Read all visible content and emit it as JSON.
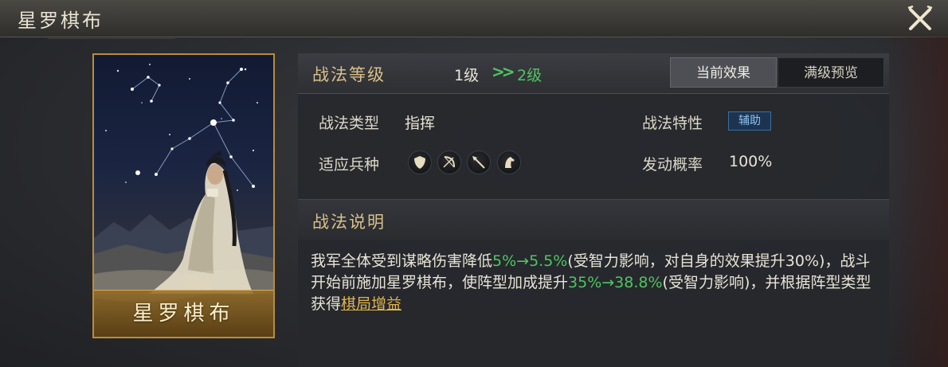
{
  "window": {
    "title": "星罗棋布"
  },
  "card": {
    "name": "星罗棋布"
  },
  "level": {
    "label": "战法等级",
    "from": "1级",
    "arrow": ">>",
    "to": "2级"
  },
  "tabs": [
    {
      "label": "当前效果",
      "active": true
    },
    {
      "label": "满级预览",
      "active": false
    }
  ],
  "attributes": {
    "type_label": "战法类型",
    "type_value": "指挥",
    "trait_label": "战法特性",
    "trait_value": "辅助",
    "units_label": "适应兵种",
    "units": [
      "shield-unit-icon",
      "bow-unit-icon",
      "spear-unit-icon",
      "cavalry-unit-icon"
    ],
    "chance_label": "发动概率",
    "chance_value": "100%"
  },
  "description": {
    "header": "战法说明",
    "p1": "我军全体受到谋略伤害降低",
    "v1": "5%→5.5%",
    "p2": "(受智力影响，对自身的效果提升30%)，战斗开始前施加星罗棋布，使阵型加成提升",
    "v2": "35%→38.8%",
    "p3": "(受智力影响)，并根据阵型类型获得",
    "link": "棋局增益"
  },
  "colors": {
    "accent_gold": "#d9c08a",
    "upgrade_green": "#4fc560",
    "link_gold": "#e0b54e",
    "badge_blue": "#8fc3f0"
  }
}
